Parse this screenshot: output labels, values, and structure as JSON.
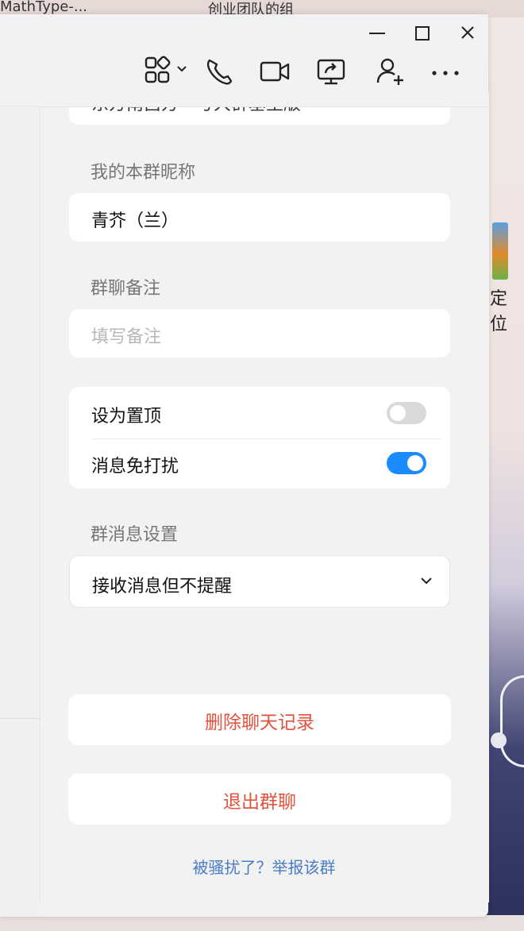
{
  "desktop": {
    "taskbar_left_text": "MathType-...",
    "taskbar_mid_text": "创业团队的组",
    "icon_label": "定位"
  },
  "window_controls": {
    "minimize_icon": "minimize-icon",
    "maximize_icon": "maximize-icon",
    "close_icon": "close-icon"
  },
  "toolbar": {
    "icons": [
      "apps-icon",
      "phone-icon",
      "video-icon",
      "screen-share-icon",
      "add-user-icon",
      "more-icon"
    ]
  },
  "settings": {
    "truncated_value": "东方南昌方一号大群基主版",
    "my_nickname_label": "我的本群昵称",
    "my_nickname_value": "青芥（兰）",
    "group_remark_label": "群聊备注",
    "group_remark_placeholder": "填写备注",
    "pin_label": "设为置顶",
    "pin_on": false,
    "dnd_label": "消息免打扰",
    "dnd_on": true,
    "msg_settings_label": "群消息设置",
    "msg_settings_value": "接收消息但不提醒"
  },
  "actions": {
    "delete_history": "删除聊天记录",
    "leave_group": "退出群聊",
    "report": "被骚扰了？举报该群"
  },
  "colors": {
    "accent": "#1a8cff",
    "danger": "#e0533f",
    "link": "#4a7cc6",
    "toggle_off": "#d9d9d9"
  }
}
